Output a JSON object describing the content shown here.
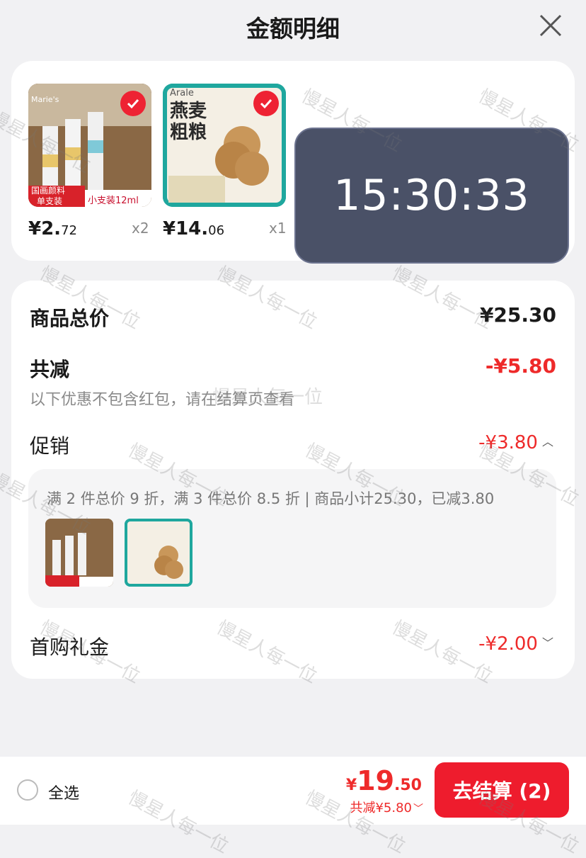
{
  "header": {
    "title": "金额明细"
  },
  "items": [
    {
      "price_int": "¥2.",
      "price_dec": "72",
      "qty": "x2",
      "label1": "国画颜料",
      "label2": "单支装",
      "label3": "小支装12ml",
      "brand": "Marie's"
    },
    {
      "price_int": "¥14.",
      "price_dec": "06",
      "qty": "x1",
      "brand": "Arale",
      "title": "燕麦粗粮"
    }
  ],
  "timer": "15:30:33",
  "summary": {
    "total_label": "商品总价",
    "total_value": "¥25.30",
    "discount_label": "共减",
    "discount_value": "-¥5.80",
    "note": "以下优惠不包含红包，请在结算页查看",
    "promo_label": "促销",
    "promo_value": "-¥3.80",
    "promo_detail": "满 2 件总价 9 折，满 3 件总价 8.5 折 | 商品小计25.30，已减3.80",
    "gift_label": "首购礼金",
    "gift_value": "-¥2.00"
  },
  "bottom": {
    "select_all": "全选",
    "total_cur": "¥",
    "total_int": "19",
    "total_dec": ".50",
    "saved": "共减¥5.80",
    "pay_button": "去结算 (2)"
  },
  "watermark": "慢星人每一位",
  "colors": {
    "accent": "#ee1c2d",
    "price_red": "#ee2a2a",
    "timer_bg": "#4a5167"
  }
}
